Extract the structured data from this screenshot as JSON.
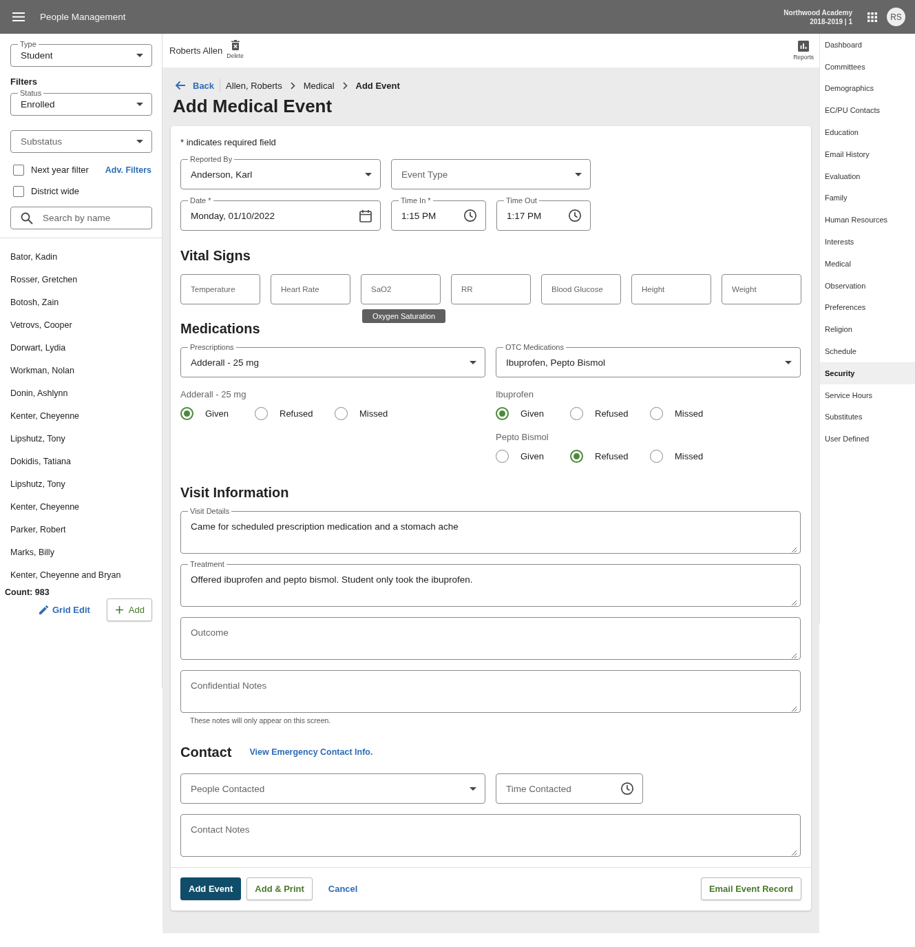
{
  "app_bar": {
    "title": "People Management",
    "school": "Northwood Academy",
    "term": "2018-2019 | 1",
    "avatar": "RS"
  },
  "sidebar": {
    "type": {
      "label": "Type",
      "value": "Student"
    },
    "filters_heading": "Filters",
    "status": {
      "label": "Status",
      "value": "Enrolled"
    },
    "substatus": {
      "placeholder": "Substatus"
    },
    "checkboxes": [
      {
        "label": "Next year filter",
        "checked": false
      },
      {
        "label": "District wide",
        "checked": false
      }
    ],
    "adv_filters": "Adv. Filters",
    "search": {
      "placeholder": "Search by name"
    },
    "people": [
      "Bator, Kadin",
      "Rosser, Gretchen",
      "Botosh, Zain",
      "Vetrovs, Cooper",
      "Dorwart, Lydia",
      "Workman, Nolan",
      "Donin, Ashlynn",
      "Kenter, Cheyenne",
      "Lipshutz, Tony",
      "Dokidis, Tatiana",
      "Lipshutz, Tony",
      "Kenter, Cheyenne",
      "Parker, Robert",
      "Marks, Billy",
      "Kenter, Cheyenne and Bryan"
    ],
    "count": "Count: 983",
    "grid_edit": "Grid Edit",
    "add": "Add"
  },
  "record_bar": {
    "name": "Roberts Allen",
    "delete": "Delete",
    "reports": "Reports"
  },
  "breadcrumb": {
    "back": "Back",
    "items": [
      "Allen, Roberts",
      "Medical",
      "Add Event"
    ]
  },
  "page_title": "Add Medical Event",
  "form": {
    "required_note": "* indicates required field",
    "reported_by": {
      "label": "Reported By",
      "value": "Anderson, Karl"
    },
    "event_type": {
      "placeholder": "Event Type"
    },
    "date": {
      "label": "Date *",
      "value": "Monday, 01/10/2022"
    },
    "time_in": {
      "label": "Time In *",
      "value": "1:15 PM"
    },
    "time_out": {
      "label": "Time Out",
      "value": "1:17 PM"
    },
    "vital_signs": {
      "heading": "Vital Signs",
      "fields": [
        {
          "placeholder": "Temperature"
        },
        {
          "placeholder": "Heart Rate"
        },
        {
          "placeholder": "SaO2",
          "tooltip": "Oxygen Saturation"
        },
        {
          "placeholder": "RR"
        },
        {
          "placeholder": "Blood Glucose"
        },
        {
          "placeholder": "Height"
        },
        {
          "placeholder": "Weight"
        }
      ]
    },
    "medications": {
      "heading": "Medications",
      "prescriptions": {
        "label": "Prescriptions",
        "value": "Adderall - 25 mg"
      },
      "otc": {
        "label": "OTC Medications",
        "value": "Ibuprofen, Pepto Bismol"
      },
      "prescription_groups": [
        {
          "name": "Adderall - 25 mg",
          "options": [
            {
              "label": "Given",
              "selected": true
            },
            {
              "label": "Refused",
              "selected": false
            },
            {
              "label": "Missed",
              "selected": false
            }
          ]
        }
      ],
      "otc_groups": [
        {
          "name": "Ibuprofen",
          "options": [
            {
              "label": "Given",
              "selected": true
            },
            {
              "label": "Refused",
              "selected": false
            },
            {
              "label": "Missed",
              "selected": false
            }
          ]
        },
        {
          "name": "Pepto Bismol",
          "options": [
            {
              "label": "Given",
              "selected": false
            },
            {
              "label": "Refused",
              "selected": true
            },
            {
              "label": "Missed",
              "selected": false
            }
          ]
        }
      ]
    },
    "visit": {
      "heading": "Visit Information",
      "fields": [
        {
          "label": "Visit Details",
          "value": "Came for scheduled prescription medication and a stomach ache"
        },
        {
          "label": "Treatment",
          "value": "Offered ibuprofen and pepto bismol. Student only took the ibuprofen."
        },
        {
          "placeholder": "Outcome"
        },
        {
          "placeholder": "Confidential Notes",
          "helper": "These notes will only appear on this screen."
        }
      ]
    },
    "contact": {
      "heading": "Contact",
      "link": "View Emergency Contact Info.",
      "people_contacted": {
        "placeholder": "People Contacted"
      },
      "time_contacted": {
        "placeholder": "Time Contacted"
      },
      "notes": {
        "placeholder": "Contact Notes"
      }
    },
    "actions": [
      {
        "label": "Add Event",
        "kind": "primary"
      },
      {
        "label": "Add & Print",
        "kind": "secondary"
      },
      {
        "label": "Cancel",
        "kind": "text"
      }
    ],
    "email_action": "Email Event Record"
  },
  "nav": {
    "items": [
      {
        "label": "Dashboard",
        "selected": false
      },
      {
        "label": "Committees",
        "selected": false
      },
      {
        "label": "Demographics",
        "selected": false
      },
      {
        "label": "EC/PU Contacts",
        "selected": false
      },
      {
        "label": "Education",
        "selected": false
      },
      {
        "label": "Email History",
        "selected": false
      },
      {
        "label": "Evaluation",
        "selected": false
      },
      {
        "label": "Family",
        "selected": false
      },
      {
        "label": "Human Resources",
        "selected": false
      },
      {
        "label": "Interests",
        "selected": false
      },
      {
        "label": "Medical",
        "selected": false
      },
      {
        "label": "Observation",
        "selected": false
      },
      {
        "label": "Preferences",
        "selected": false
      },
      {
        "label": "Religion",
        "selected": false
      },
      {
        "label": "Schedule",
        "selected": false
      },
      {
        "label": "Security",
        "selected": true
      },
      {
        "label": "Service Hours",
        "selected": false
      },
      {
        "label": "Substitutes",
        "selected": false
      },
      {
        "label": "User Defined",
        "selected": false
      }
    ]
  }
}
